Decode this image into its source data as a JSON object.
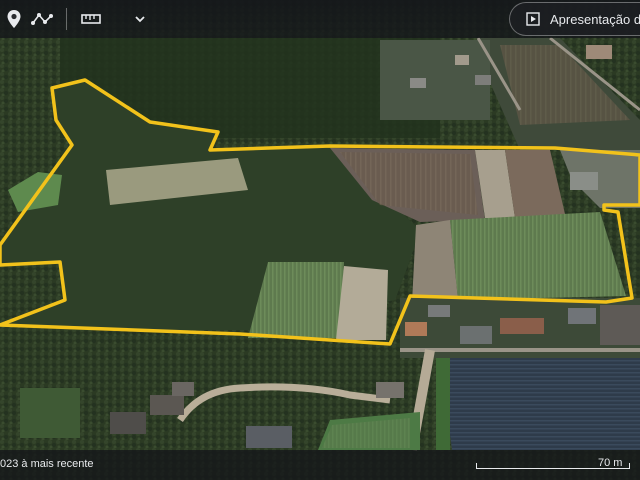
{
  "toolbar": {
    "location_icon": "location-pin-icon",
    "path_icon": "path-icon",
    "measure_icon": "ruler-icon",
    "dropdown_icon": "chevron-down-icon",
    "presentation_label": "Apresentação de",
    "presentation_icon": "play-square-icon"
  },
  "footer": {
    "imagery_date": "023 à mais recente",
    "scale_label": "70 m"
  },
  "map": {
    "imagery": "satellite",
    "boundary_color": "#f2c21b"
  }
}
